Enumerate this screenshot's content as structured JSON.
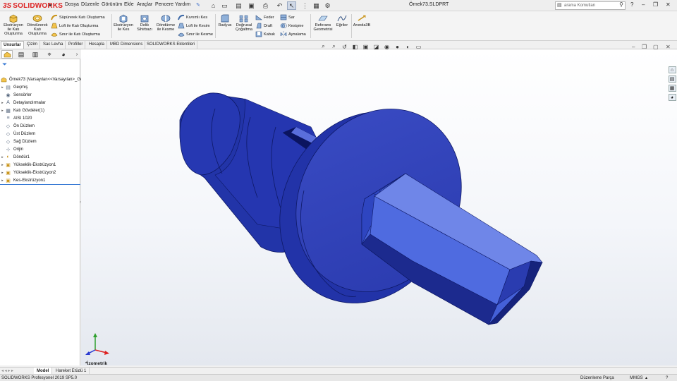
{
  "app": {
    "logo_ds": "3S",
    "logo_name": "SOLIDWORKS",
    "document_title": "Örnek73.SLDPRT"
  },
  "menu": [
    "Dosya",
    "Düzenle",
    "Görünüm",
    "Ekle",
    "Araçlar",
    "Pencere",
    "Yardım"
  ],
  "search": {
    "placeholder": "arama Komutları"
  },
  "commands": {
    "extrude_boss": "Ekstrüzyon ile Katı Oluşturma",
    "revolve_boss": "Döndürerek Katı Oluşturma",
    "sweep_boss": "Süpürerek Katı Oluşturma",
    "loft_boss": "Loft ile Katı Oluşturma",
    "boundary_boss": "Sınır ile Katı Oluşturma",
    "extruded_cut": "Ekstrüzyon ile Kes",
    "hole_wizard": "Delik Sihirbazı",
    "revolved_cut": "Döndürme ile Kesme",
    "swept_cut": "Kıvrımlı Kes",
    "lofted_cut": "Loft ile Kesim",
    "boundary_cut": "Sınır ile Kesme",
    "fillet": "Radyus",
    "linear_pattern": "Doğrusal Çoğaltma",
    "rib": "Feder",
    "draft": "Draft",
    "shell": "Kabuk",
    "wrap": "Sar",
    "intersect": "Kesişme",
    "mirror": "Aynalama",
    "reference_geometry": "Referans Geometrisi",
    "curves": "Eğriler",
    "instant3d": "Anında3B"
  },
  "tabs": [
    "Unsurlar",
    "Çizim",
    "Sac Levha",
    "Profiller",
    "Hesapla",
    "MBD Dimensions",
    "SOLIDWORKS Eklentileri"
  ],
  "tree": {
    "root": "Örnek73 (Varsayılan<<Varsayılan>_Gö",
    "items": [
      {
        "label": "Geçmiş",
        "icon": "history-icon",
        "expand": true
      },
      {
        "label": "Sensörler",
        "icon": "sensor-icon",
        "expand": false
      },
      {
        "label": "Detaylandırmalar",
        "icon": "annotation-icon",
        "expand": true
      },
      {
        "label": "Katı Gövdeler(1)",
        "icon": "solid-bodies-icon",
        "expand": true
      },
      {
        "label": "AISI 1020",
        "icon": "material-icon",
        "expand": false
      },
      {
        "label": "Ön Düzlem",
        "icon": "plane-icon",
        "expand": false
      },
      {
        "label": "Üst Düzlem",
        "icon": "plane-icon",
        "expand": false
      },
      {
        "label": "Sağ Düzlem",
        "icon": "plane-icon",
        "expand": false
      },
      {
        "label": "Orijin",
        "icon": "origin-icon",
        "expand": false
      },
      {
        "label": "Döndür1",
        "icon": "revolve-feature-icon",
        "expand": true
      },
      {
        "label": "Yükseklik-Ekstrüzyon1",
        "icon": "extrude-feature-icon",
        "expand": true
      },
      {
        "label": "Yükseklik-Ekstrüzyon2",
        "icon": "extrude-feature-icon",
        "expand": true
      },
      {
        "label": "Kes-Ekstrüzyon1",
        "icon": "cut-extrude-feature-icon",
        "expand": true
      }
    ]
  },
  "viewport": {
    "view_label": "*İzometrik"
  },
  "bottom_tabs": [
    "Model",
    "Hareket Etüdü 1"
  ],
  "status": {
    "product": "SOLIDWORKS Profesyonel 2019 SP5.0",
    "mode": "Düzenleme Parça",
    "units": "MMGS"
  },
  "colors": {
    "part_blue": "#2b3cae",
    "brand_red": "#d22222",
    "selection_blue": "#3a7bd5"
  }
}
